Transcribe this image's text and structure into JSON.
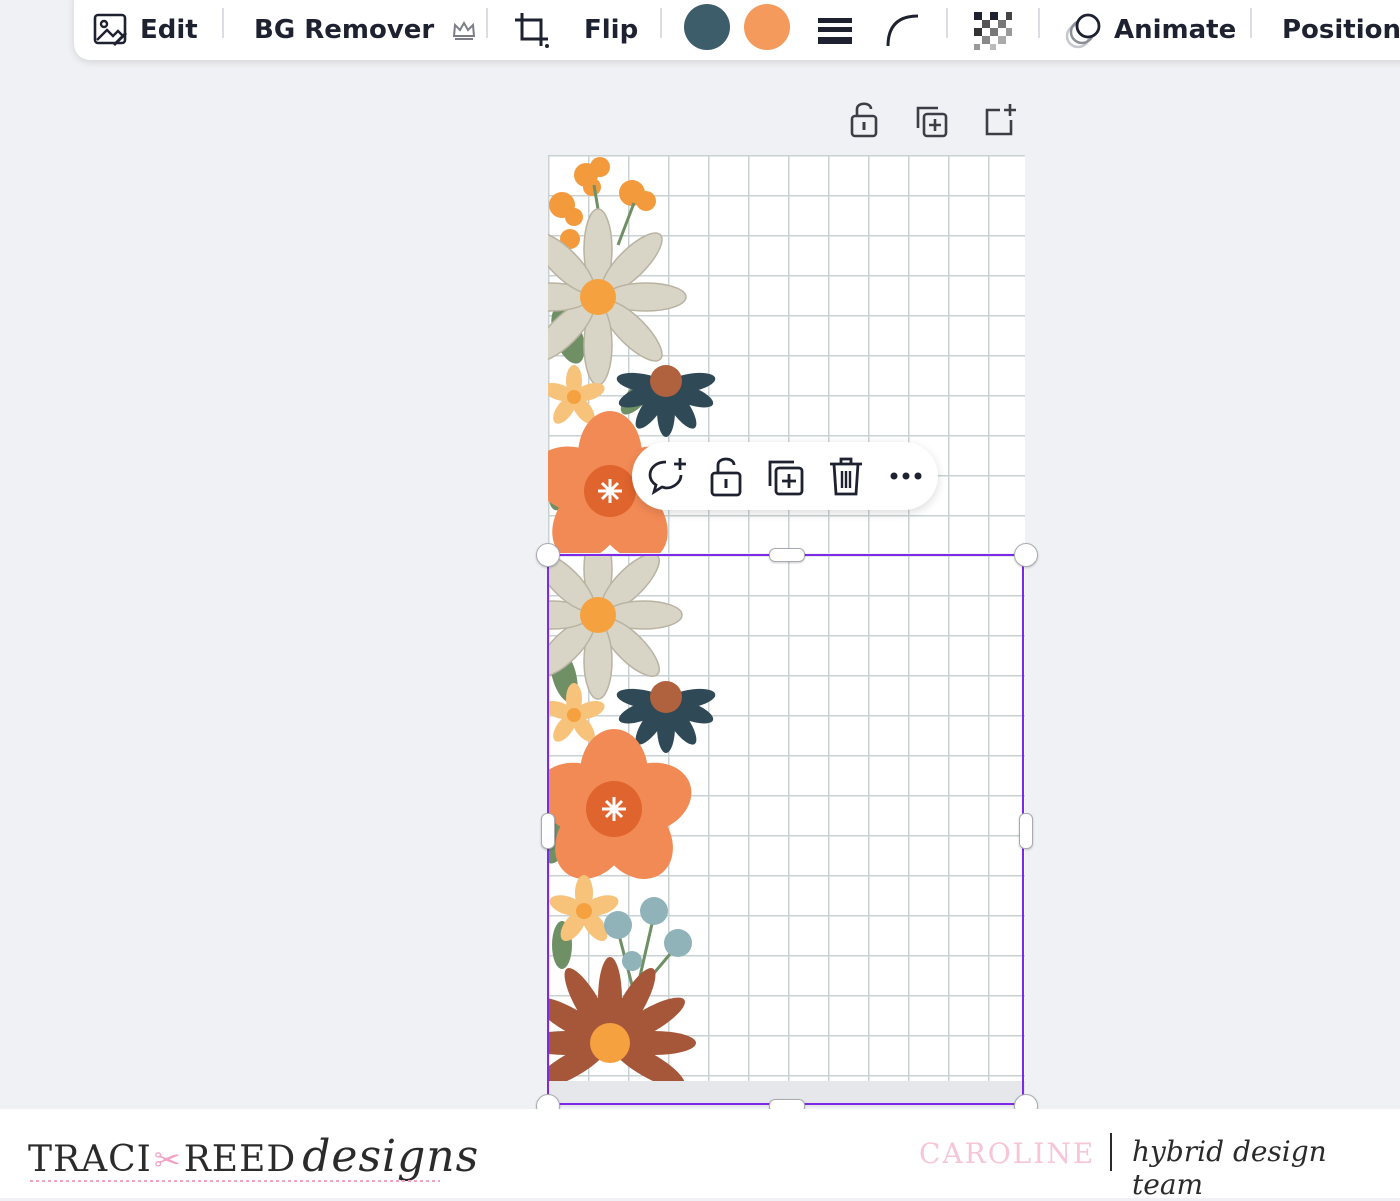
{
  "toolbar": {
    "edit_label": "Edit",
    "bg_remover_label": "BG Remover",
    "flip_label": "Flip",
    "animate_label": "Animate",
    "position_label": "Position",
    "icons": {
      "edit": "edit-image-icon",
      "premium": "crown-icon",
      "crop": "crop-icon",
      "border_style": "border-style-icon",
      "corner_rounding": "corner-rounding-icon",
      "transparency": "transparency-icon",
      "animate": "animate-icon"
    },
    "colors": {
      "swatch_1": "#3d5d6b",
      "swatch_2": "#f49a5c"
    }
  },
  "page_actions": {
    "icons": [
      "unlock-icon",
      "duplicate-page-icon",
      "add-page-icon"
    ]
  },
  "context_menu": {
    "icons": [
      "add-comment-icon",
      "unlock-icon",
      "duplicate-icon",
      "delete-icon",
      "more-icon"
    ]
  },
  "selection": {
    "accent": "#7d2ae8"
  },
  "footer": {
    "brand_part1": "TRACI",
    "brand_part2": "REED",
    "brand_script": "designs",
    "name": "CAROLINE",
    "team": "hybrid design team"
  }
}
